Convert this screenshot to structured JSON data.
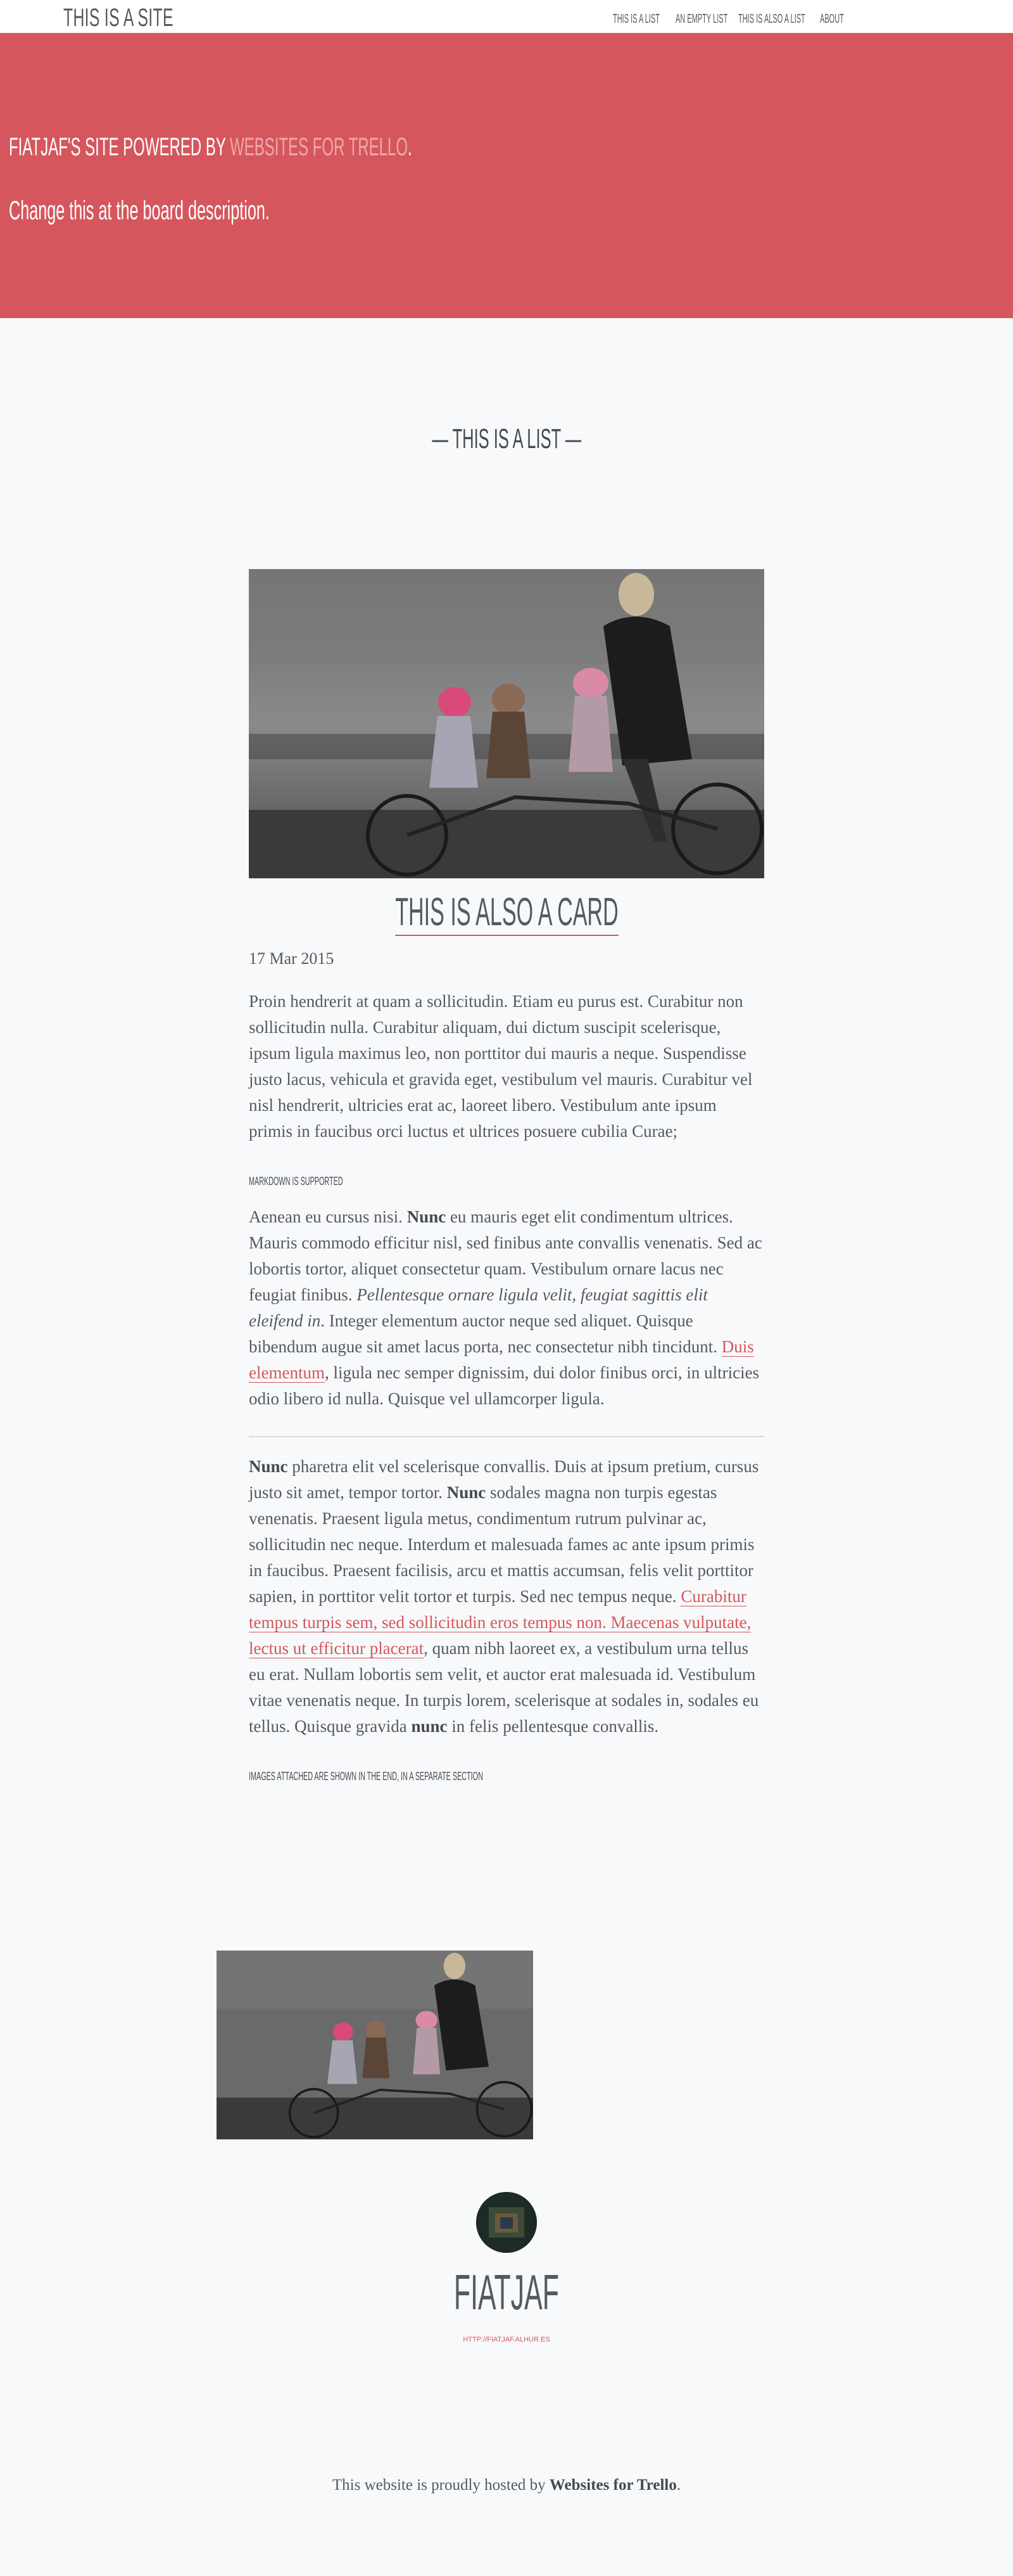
{
  "header": {
    "site_title": "THIS IS A SITE",
    "nav": [
      {
        "label": "THIS IS A LIST"
      },
      {
        "label": "AN EMPTY LIST"
      },
      {
        "label": "THIS IS ALSO A LIST"
      },
      {
        "label": "ABOUT"
      }
    ]
  },
  "hero": {
    "line1_prefix": "FIATJAF'S SITE POWERED BY ",
    "line1_link": "WEBSITES FOR TRELLO",
    "line1_suffix": ".",
    "line2": "Change this at the board description."
  },
  "list": {
    "heading": "— THIS IS A LIST —"
  },
  "card": {
    "title": "THIS IS ALSO A CARD",
    "date": "17 Mar 2015",
    "paragraph1": "Proin hendrerit at quam a sollicitudin. Etiam eu purus est. Curabitur non sollicitudin nulla. Curabitur aliquam, dui dictum suscipit scelerisque, ipsum ligula maximus leo, non porttitor dui mauris a neque. Suspendisse justo lacus, vehicula et gravida eget, vestibulum vel mauris. Curabitur vel nisl hendrerit, ultricies erat ac, laoreet libero. Vestibulum ante ipsum primis in faucibus orci luctus et ultrices posuere cubilia Curae;",
    "subheading1": "MARKDOWN IS SUPPORTED",
    "p2": {
      "a": "Aenean eu cursus nisi. ",
      "b": "Nunc",
      "c": " eu mauris eget elit condimentum ultrices. Mauris commodo efficitur nisl, sed finibus ante convallis venenatis. Sed ac lobortis tortor, aliquet consectetur quam. Vestibulum ornare lacus nec feugiat finibus. ",
      "d": "Pellentesque ornare ligula velit, feugiat sagittis elit eleifend in",
      "e": ". Integer elementum auctor neque sed aliquet. Quisque bibendum augue sit amet lacus porta, nec consectetur nibh tincidunt. ",
      "f": "Duis elementum",
      "g": ", ligula nec semper dignissim, dui dolor finibus orci, in ultricies odio libero id nulla. Quisque vel ullamcorper ligula."
    },
    "p3": {
      "a": "Nunc",
      "b": " pharetra elit vel scelerisque convallis. Duis at ipsum pretium, cursus justo sit amet, tempor tortor. ",
      "c": "Nunc",
      "d": " sodales magna non turpis egestas venenatis. Praesent ligula metus, condimentum rutrum pulvinar ac, sollicitudin nec neque. Interdum et malesuada fames ac ante ipsum primis in faucibus. Praesent facilisis, arcu et mattis accumsan, felis velit porttitor sapien, in porttitor velit tortor et turpis. Sed nec tempus neque. ",
      "e": "Curabitur tempus turpis sem, sed sollicitudin eros tempus non. Maecenas vulputate, lectus ut efficitur placerat",
      "f": ", quam nibh laoreet ex, a vestibulum urna tellus eu erat. Nullam lobortis sem velit, et auctor erat malesuada id. Vestibulum vitae venenatis neque. In turpis lorem, scelerisque at sodales in, sodales eu tellus. Quisque gravida ",
      "g": "nunc",
      "h": " in felis pellentesque convallis."
    },
    "subheading2": "IMAGES ATTACHED ARE SHOWN IN THE END, IN A SEPARATE SECTION"
  },
  "author": {
    "name": "FIATJAF",
    "link": "HTTP://FIATJAF.ALHUR.ES"
  },
  "footer": {
    "text": "This website is proudly hosted by ",
    "brand": "Websites for Trello",
    "end": "."
  },
  "colors": {
    "accent": "#d5575d",
    "background": "#f8f9fa",
    "text": "#555a5f"
  }
}
